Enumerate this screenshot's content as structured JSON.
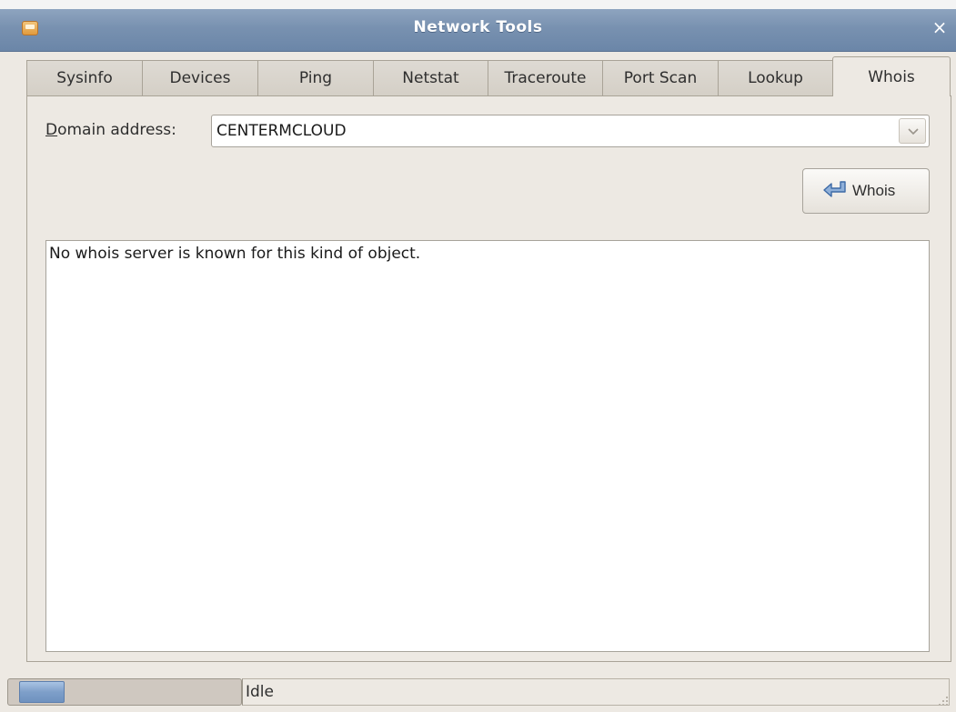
{
  "window": {
    "title": "Network Tools",
    "close_glyph": "×"
  },
  "tabs": [
    {
      "label": "Sysinfo",
      "active": false
    },
    {
      "label": "Devices",
      "active": false
    },
    {
      "label": "Ping",
      "active": false
    },
    {
      "label": "Netstat",
      "active": false
    },
    {
      "label": "Traceroute",
      "active": false
    },
    {
      "label": "Port Scan",
      "active": false
    },
    {
      "label": "Lookup",
      "active": false
    },
    {
      "label": "Whois",
      "active": true
    }
  ],
  "whois": {
    "domain_label_mnemonic": "D",
    "domain_label_rest": "omain address:",
    "domain_value": "CENTERMCLOUD",
    "button_label": "Whois",
    "button_icon": "enter-arrow-icon",
    "output_text": "No whois server is known for this kind of object."
  },
  "status": {
    "text": "Idle",
    "progress_style": "pulsing"
  },
  "colors": {
    "titlebar": "#7891b0",
    "window_bg": "#ede9e3",
    "progress_fill": "#7e9fc9"
  }
}
